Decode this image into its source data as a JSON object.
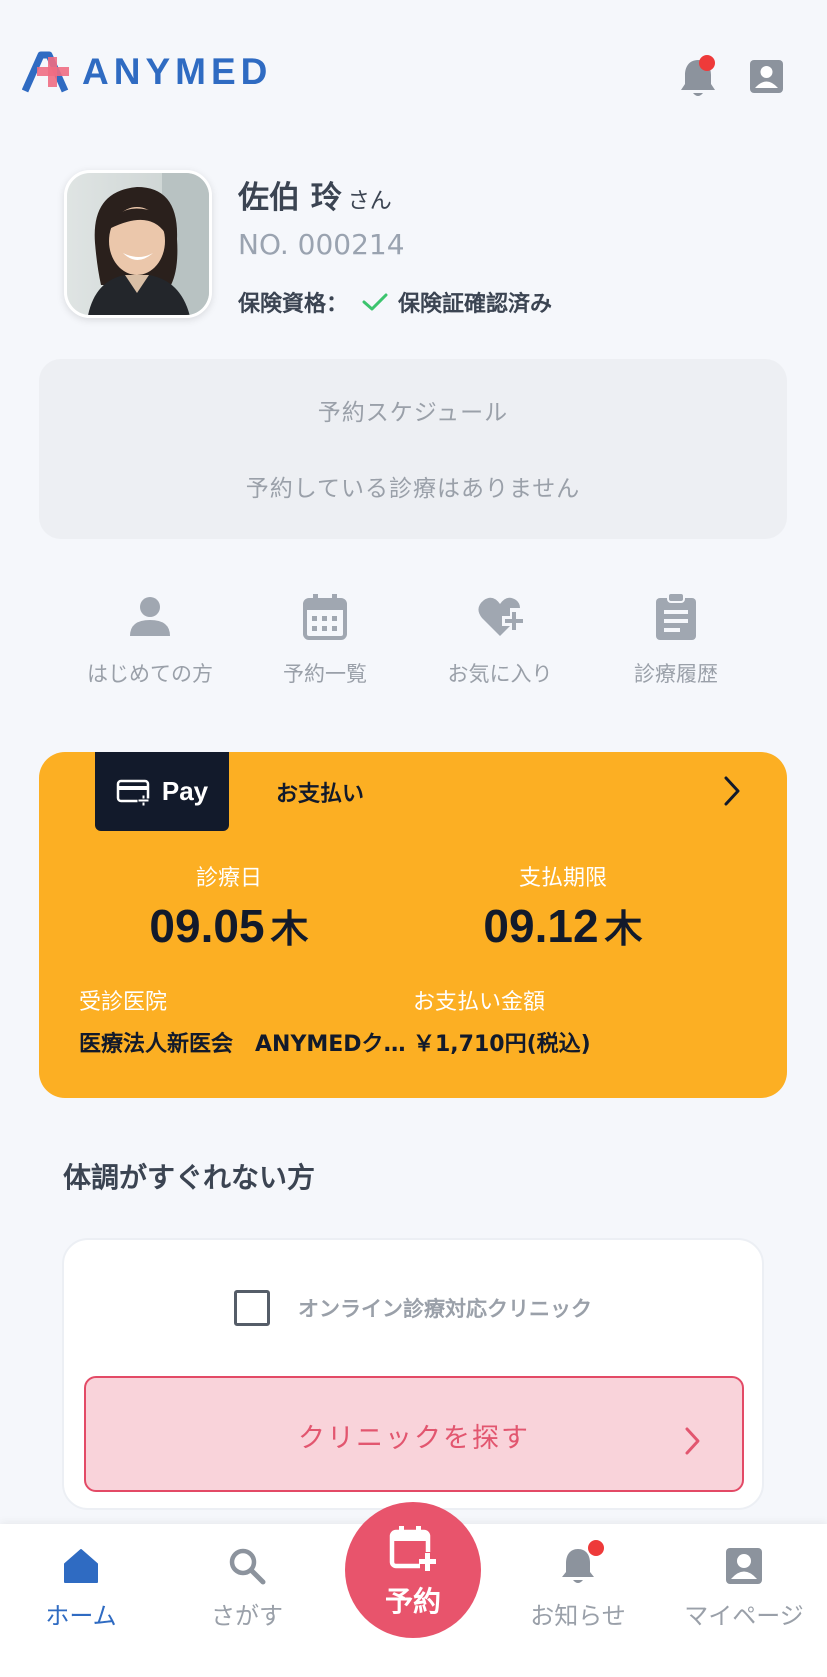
{
  "header": {
    "logo_text": "ANYMED",
    "has_notification": true
  },
  "profile": {
    "name": "佐伯 玲",
    "name_suffix": "さん",
    "patient_no": "NO. 000214",
    "insurance_label": "保険資格：",
    "insurance_status": "保険証確認済み"
  },
  "schedule": {
    "title": "予約スケジュール",
    "empty_message": "予約している診療はありません"
  },
  "quick_menu": [
    {
      "label": "はじめての方",
      "icon": "person-icon"
    },
    {
      "label": "予約一覧",
      "icon": "calendar-icon"
    },
    {
      "label": "お気に入り",
      "icon": "heart-plus-icon"
    },
    {
      "label": "診療履歴",
      "icon": "clipboard-icon"
    }
  ],
  "payment": {
    "tab_label": "Pay",
    "title": "お支払い",
    "visit_date_label": "診療日",
    "visit_date": "09.05",
    "visit_dow": "木",
    "due_date_label": "支払期限",
    "due_date": "09.12",
    "due_dow": "木",
    "clinic_label": "受診医院",
    "clinic_name": "医療法人新医会　ANYMEDクリニック",
    "amount_label": "お支払い金額",
    "amount": "￥1,710円(税込)"
  },
  "unwell": {
    "title": "体調がすぐれない方",
    "online_filter_label": "オンライン診療対応クリニック",
    "online_filter_checked": false,
    "find_button": "クリニックを探す"
  },
  "bottom_nav": {
    "home": "ホーム",
    "search": "さがす",
    "reserve": "予約",
    "notifications": "お知らせ",
    "mypage": "マイページ",
    "active": "home"
  },
  "colors": {
    "brand_blue": "#2f6bc2",
    "brand_pink": "#e8546c",
    "payment_orange": "#fcaf23",
    "dark_navy": "#121a2b",
    "alert_red": "#ee3a3a",
    "check_green": "#3cc46e"
  }
}
